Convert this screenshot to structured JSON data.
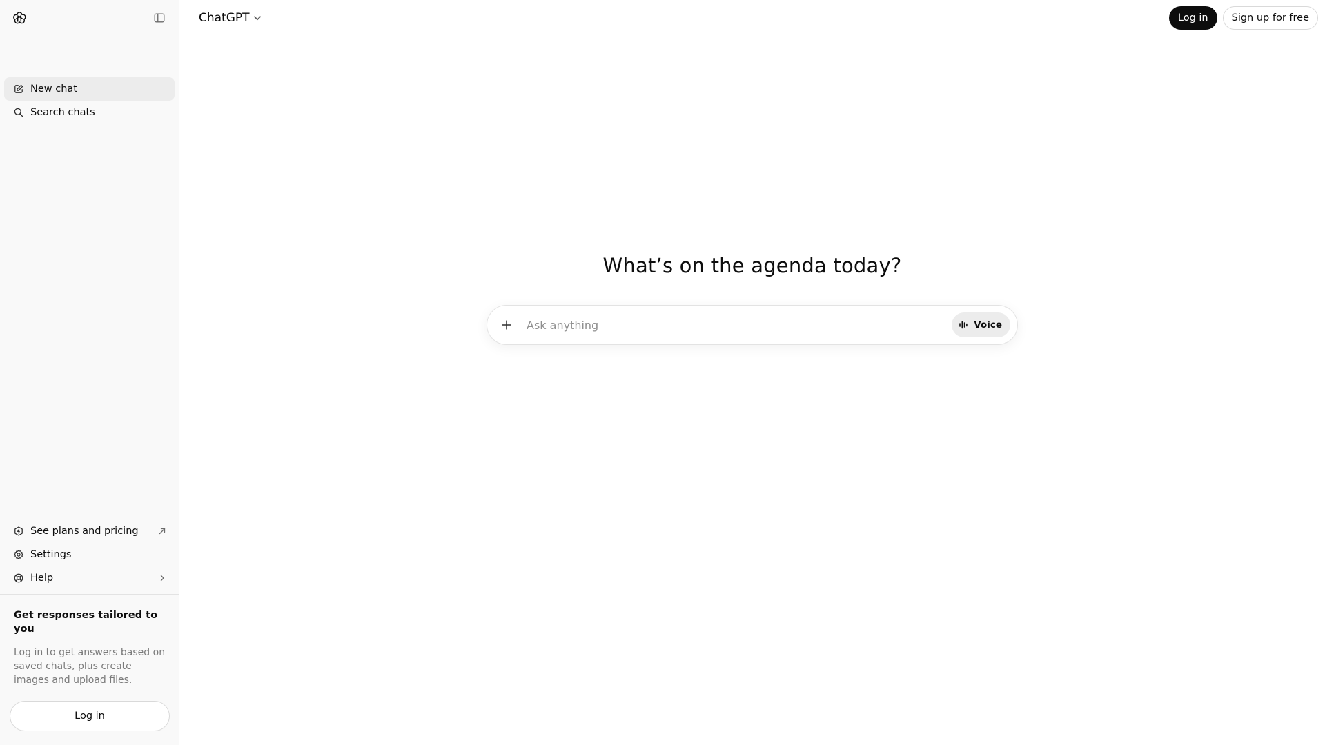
{
  "sidebar": {
    "nav": [
      {
        "label": "New chat",
        "icon": "edit-icon"
      },
      {
        "label": "Search chats",
        "icon": "search-icon"
      }
    ],
    "bottom": [
      {
        "label": "See plans and pricing",
        "icon": "plans-icon"
      },
      {
        "label": "Settings",
        "icon": "gear-icon"
      },
      {
        "label": "Help",
        "icon": "help-icon"
      }
    ],
    "promo": {
      "title": "Get responses tailored to you",
      "text": "Log in to get answers based on saved chats, plus create images and upload files.",
      "login_label": "Log in"
    }
  },
  "header": {
    "model_name": "ChatGPT",
    "login_label": "Log in",
    "signup_label": "Sign up for free"
  },
  "main": {
    "headline": "What’s on the agenda today?",
    "composer": {
      "placeholder": "Ask anything",
      "value": "",
      "voice_label": "Voice"
    }
  }
}
